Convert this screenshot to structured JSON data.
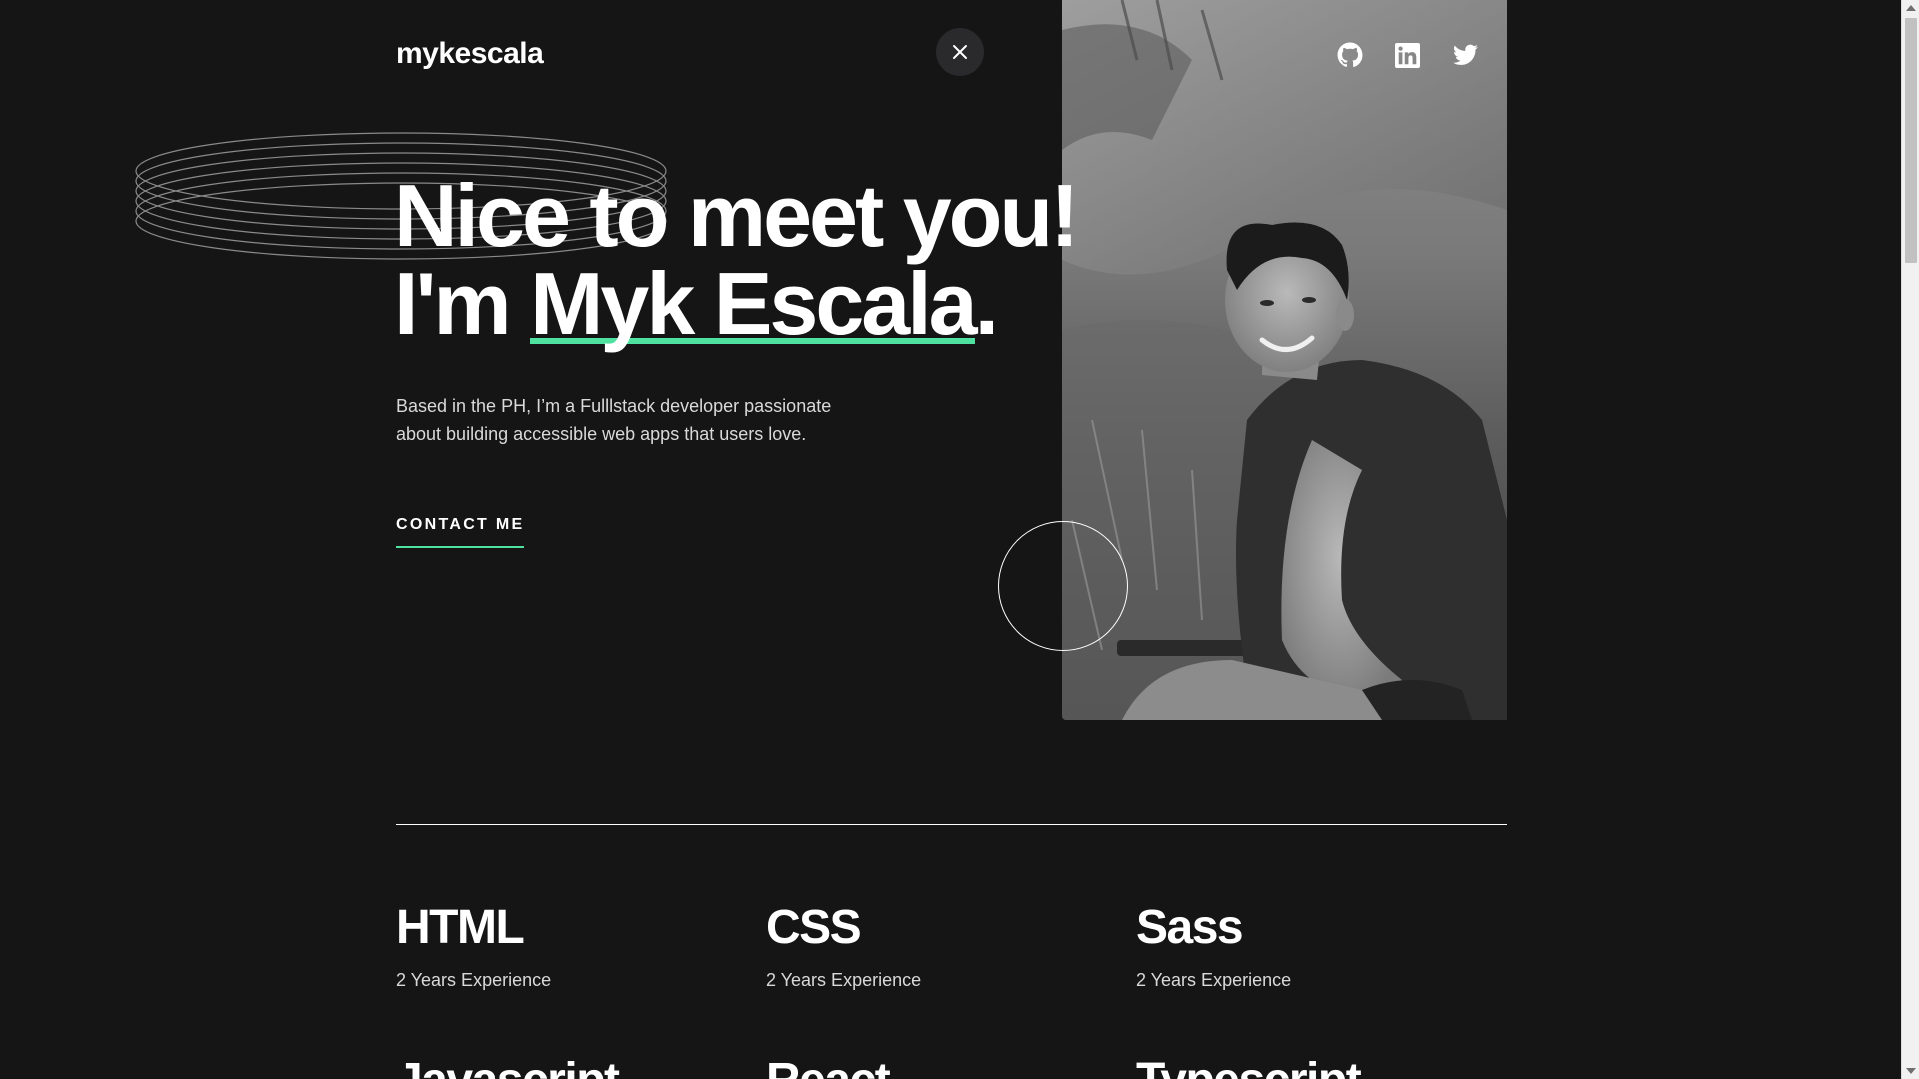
{
  "header": {
    "logo": "mykescala",
    "close_icon": "close-icon",
    "social": [
      {
        "name": "GitHub",
        "icon": "github-icon"
      },
      {
        "name": "LinkedIn",
        "icon": "linkedin-icon"
      },
      {
        "name": "Twitter",
        "icon": "twitter-icon"
      }
    ]
  },
  "hero": {
    "title_line1": "Nice to meet you!",
    "title_prefix": "I'm ",
    "title_name": "Myk Escala",
    "title_suffix": ".",
    "intro_line1": "Based in the PH, I’m a Fulllstack developer passionate",
    "intro_line2": "about building accessible web apps that users love.",
    "contact_label": "CONTACT ME",
    "photo_alt": "Portrait photo of Myk Escala"
  },
  "skills": [
    {
      "name": "HTML",
      "experience": "2 Years Experience"
    },
    {
      "name": "CSS",
      "experience": "2 Years Experience"
    },
    {
      "name": "Sass",
      "experience": "2 Years Experience"
    },
    {
      "name": "Javascript",
      "experience": ""
    },
    {
      "name": "React",
      "experience": ""
    },
    {
      "name": "Typescript",
      "experience": ""
    }
  ],
  "colors": {
    "background": "#151515",
    "accent": "#4ee1a0",
    "text": "#ffffff",
    "muted_text": "#d9d9d9"
  }
}
